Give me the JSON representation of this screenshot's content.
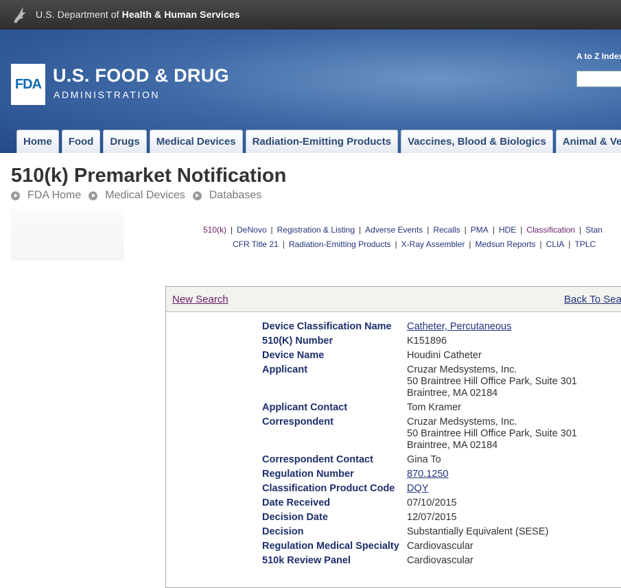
{
  "hhs": {
    "prefix": "U.S. Department of ",
    "bold": "Health & Human Services"
  },
  "brand": {
    "logo": "FDA",
    "title": "U.S. FOOD & DRUG",
    "subtitle": "ADMINISTRATION",
    "atoz": "A to Z Index"
  },
  "nav": {
    "tabs": [
      "Home",
      "Food",
      "Drugs",
      "Medical Devices",
      "Radiation-Emitting Products",
      "Vaccines, Blood & Biologics",
      "Animal & Veter"
    ]
  },
  "page": {
    "title": "510(k) Premarket Notification",
    "breadcrumb": [
      "FDA Home",
      "Medical Devices",
      "Databases"
    ]
  },
  "db_links": {
    "row1": [
      "510(k)",
      "DeNovo",
      "Registration & Listing",
      "Adverse Events",
      "Recalls",
      "PMA",
      "HDE",
      "Classification",
      "Stan"
    ],
    "row2": [
      "CFR Title 21",
      "Radiation-Emitting Products",
      "X-Ray Assembler",
      "Medsun Reports",
      "CLIA",
      "TPLC"
    ]
  },
  "result": {
    "new_search": "New Search",
    "back_to_search": "Back To Sea",
    "rows": [
      {
        "label": "Device Classification Name",
        "value": [
          "Catheter, Percutaneous"
        ],
        "link": true
      },
      {
        "label": "510(K) Number",
        "value": [
          "K151896"
        ],
        "link": false
      },
      {
        "label": "Device Name",
        "value": [
          "Houdini Catheter"
        ],
        "link": false
      },
      {
        "label": "Applicant",
        "value": [
          "Cruzar Medsystems, Inc.",
          "50 Braintree Hill Office Park, Suite 301",
          "Braintree,  MA  02184"
        ],
        "link": false
      },
      {
        "label": "Applicant Contact",
        "value": [
          "Tom Kramer"
        ],
        "link": false
      },
      {
        "label": "Correspondent",
        "value": [
          "Cruzar Medsystems, Inc.",
          "50 Braintree Hill Office Park, Suite 301",
          "Braintree,  MA  02184"
        ],
        "link": false
      },
      {
        "label": "Correspondent Contact",
        "value": [
          "Gina To"
        ],
        "link": false
      },
      {
        "label": "Regulation Number",
        "value": [
          "870.1250"
        ],
        "link": true
      },
      {
        "label": "Classification Product Code",
        "value": [
          "DQY"
        ],
        "link": true
      },
      {
        "label": "Date Received",
        "value": [
          "07/10/2015"
        ],
        "link": false
      },
      {
        "label": "Decision Date",
        "value": [
          "12/07/2015"
        ],
        "link": false
      },
      {
        "label": "Decision",
        "value": [
          "Substantially Equivalent (SESE)"
        ],
        "link": false
      },
      {
        "label": "Regulation Medical Specialty",
        "value": [
          "Cardiovascular"
        ],
        "link": false
      },
      {
        "label": "510k Review Panel",
        "value": [
          "Cardiovascular"
        ],
        "link": false
      }
    ]
  }
}
